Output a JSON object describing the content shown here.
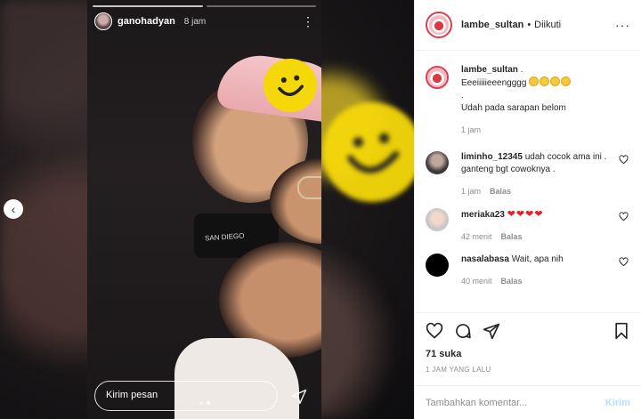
{
  "story": {
    "username": "ganohadyan",
    "time": "8 jam",
    "reply_placeholder": "Kirim pesan",
    "shirt_text": "SAN DIEGO"
  },
  "post": {
    "author": "lambe_sultan",
    "separator": "•",
    "follow_status": "Diikuti",
    "caption": {
      "username": "lambe_sultan",
      "line1": ".",
      "line2": "Eeeiiiiieeengggg",
      "line3": ".",
      "line4": "Udah pada sarapan belom",
      "time": "1 jam"
    },
    "comments": [
      {
        "username": "liminho_12345",
        "text": "udah cocok ama ini . ganteng bgt cowoknya .",
        "time": "1 jam",
        "reply": "Balas"
      },
      {
        "username": "meriaka23",
        "text": "❤❤❤❤",
        "time": "42 menit",
        "reply": "Balas"
      },
      {
        "username": "nasalabasa",
        "text": "Wait, apa nih",
        "time": "40 menit",
        "reply": "Balas"
      }
    ],
    "likes": "71 suka",
    "posted": "1 JAM YANG LALU",
    "comment_placeholder": "Tambahkan komentar...",
    "post_button": "Kirim"
  },
  "icons": {
    "heart": "heart-icon",
    "comment": "comment-icon",
    "share": "share-icon",
    "save": "bookmark-icon",
    "more": "more-icon",
    "prev": "chevron-left-icon",
    "send": "send-icon"
  },
  "colors": {
    "accent_red": "#ed1c24",
    "smiley_yellow": "#f5d80a",
    "post_button_disabled": "#b2dffc"
  }
}
